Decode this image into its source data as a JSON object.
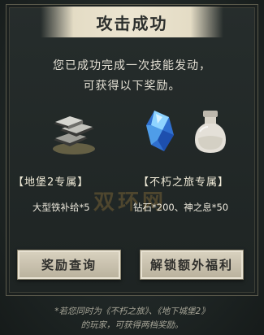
{
  "dialog": {
    "title": "攻击成功",
    "message_line1": "您已成功完成一次技能发动，",
    "message_line2": "可获得以下奖励。"
  },
  "rewards": [
    {
      "icon": "iron-ingots-icon",
      "label": "【地堡2专属】",
      "item": "大型铁补给*5"
    },
    {
      "icon": "blue-crystal-icon",
      "label": "【不朽之旅专属】",
      "item": "钻石*200、神之息*50"
    }
  ],
  "buttons": {
    "query": "奖励查询",
    "unlock": "解锁额外福利"
  },
  "footnote": {
    "line1": "*若您同时为《不朽之旅》、《地下城堡2》",
    "line2": "的玩家，可获得两档奖励。"
  },
  "watermark": "双环网"
}
